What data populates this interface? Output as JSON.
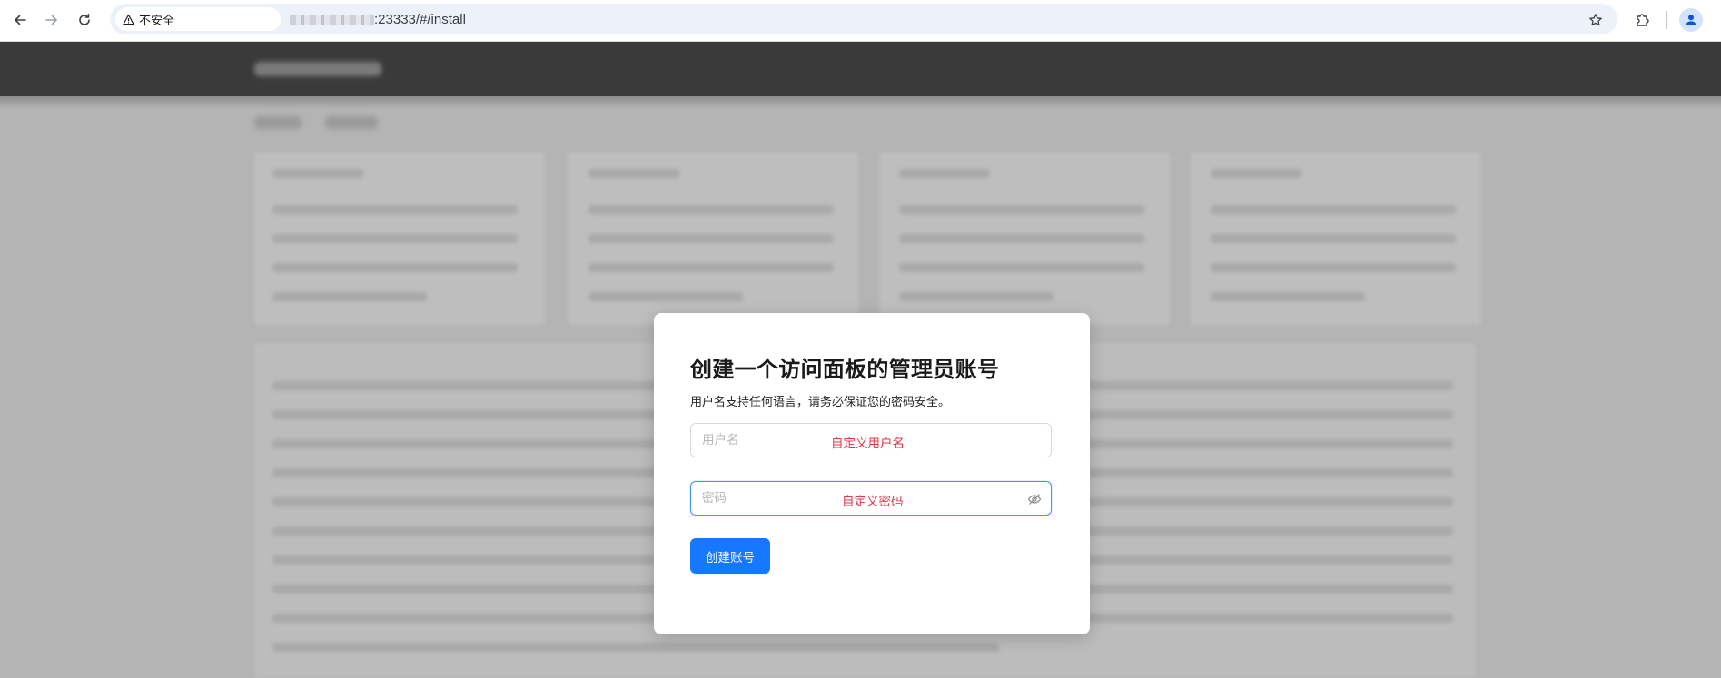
{
  "browser": {
    "security_label": "不安全",
    "url_path": ":23333/#/install"
  },
  "modal": {
    "title": "创建一个访问面板的管理员账号",
    "description": "用户名支持任何语言，请务必保证您的密码安全。",
    "username": {
      "placeholder": "用户名",
      "annotation": "自定义用户名"
    },
    "password": {
      "placeholder": "密码",
      "annotation": "自定义密码"
    },
    "submit_label": "创建账号"
  },
  "colors": {
    "primary": "#1677ff",
    "annotation": "#e8364a",
    "overlay": "#b4b4b4"
  }
}
